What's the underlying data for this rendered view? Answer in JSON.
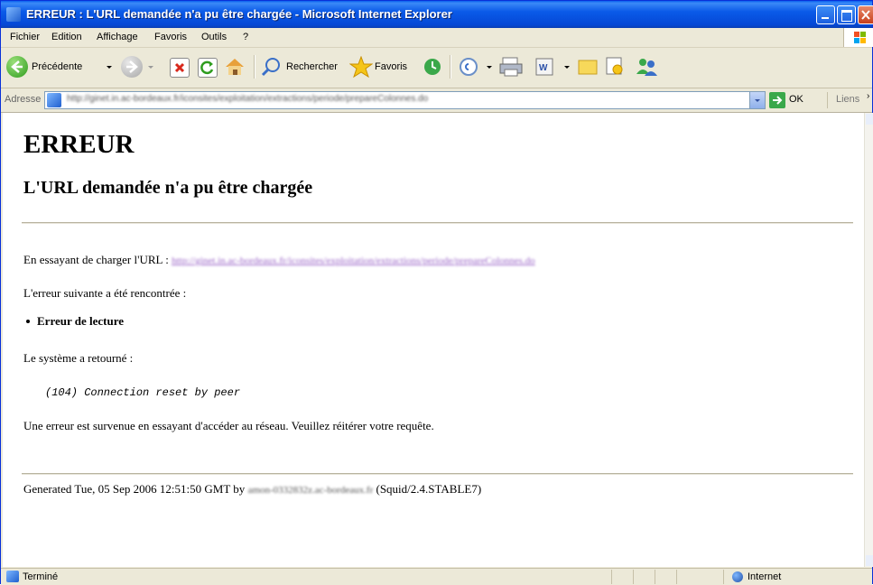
{
  "window": {
    "title": "ERREUR : L'URL demandée n'a pu être chargée - Microsoft Internet Explorer"
  },
  "menu": {
    "items": [
      "Fichier",
      "Edition",
      "Affichage",
      "Favoris",
      "Outils",
      "?"
    ]
  },
  "toolbar": {
    "back_label": "Précédente",
    "search_label": "Rechercher",
    "favorites_label": "Favoris"
  },
  "address": {
    "label": "Adresse",
    "url": "http://ginet.in.ac-bordeaux.fr/iconsites/exploitation/extractions/periode/prepareColonnes.do",
    "go_label": "OK",
    "links_label": "Liens"
  },
  "page": {
    "heading": "ERREUR",
    "subheading": "L'URL demandée n'a pu être chargée",
    "trying_text": "En essayant de charger l'URL :",
    "url_link": "http://ginet.in.ac-bordeaux.fr/iconsites/exploitation/extractions/periode/prepareColonnes.do",
    "error_intro": "L'erreur suivante a été rencontrée :",
    "error_item": "Erreur de lecture",
    "system_returned": "Le système a retourné :",
    "system_message": "(104) Connection reset by peer",
    "network_error": "Une erreur est survenue en essayant d'accéder au réseau. Veuillez réitérer votre requête.",
    "generated_prefix": "Generated Tue, 05 Sep 2006 12:51:50 GMT by",
    "generated_host": "amon-0332832z.ac-bordeaux.fr",
    "generated_suffix": "(Squid/2.4.STABLE7)"
  },
  "status": {
    "text": "Terminé",
    "zone": "Internet"
  },
  "colors": {
    "titlebar": "#0a5ae8",
    "chrome": "#ece9d8",
    "link_visited": "#9a64c8"
  }
}
